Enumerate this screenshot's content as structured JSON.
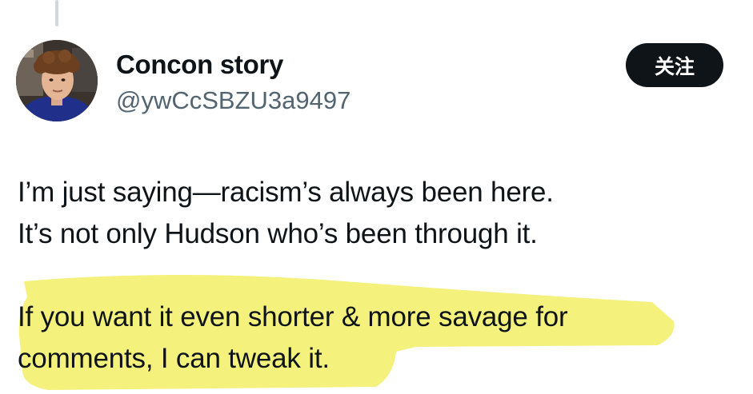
{
  "author": {
    "display_name": "Concon story",
    "handle": "@ywCcSBZU3a9497",
    "avatar_icon": "profile-photo"
  },
  "follow_button": {
    "label": "关注"
  },
  "tweet": {
    "paragraphs": [
      {
        "lines": [
          "I’m just saying—racism’s always been here.",
          "It’s not only Hudson who’s been through it."
        ]
      },
      {
        "lines": [
          "If you want it even shorter & more savage for",
          "comments, I can tweak it."
        ],
        "highlighted": true
      }
    ]
  },
  "colors": {
    "text": "#0f1419",
    "secondary_text": "#536471",
    "button_bg": "#0f1419",
    "button_text": "#ffffff",
    "highlight": "#f3ef6a",
    "thread_line": "#cfd9de"
  }
}
